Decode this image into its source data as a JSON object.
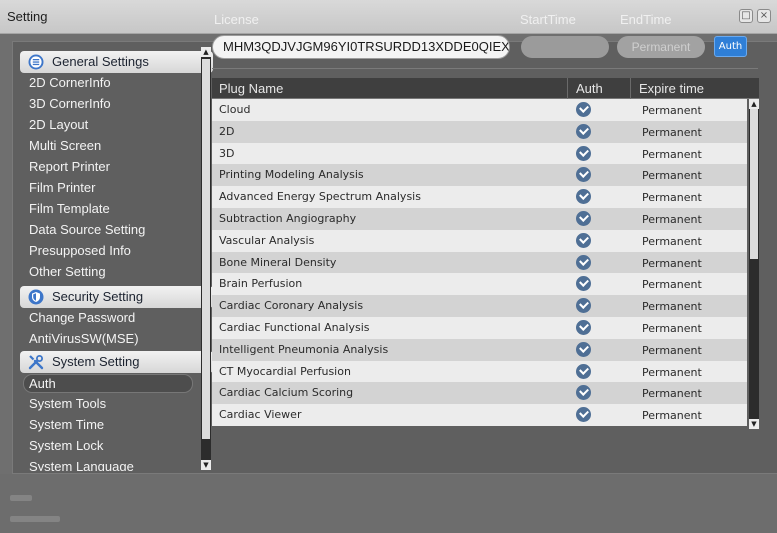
{
  "window": {
    "title": "Setting"
  },
  "sidebar": {
    "sections": [
      {
        "label": "General Settings",
        "icon": "list-circle-icon",
        "items": [
          "2D CornerInfo",
          "3D CornerInfo",
          "2D Layout",
          "Multi Screen",
          "Report Printer",
          "Film Printer",
          "Film Template",
          "Data Source Setting",
          "Presupposed Info",
          "Other Setting"
        ]
      },
      {
        "label": "Security Setting",
        "icon": "shield-icon",
        "items": [
          "Change Password",
          "AntiVirusSW(MSE)"
        ]
      },
      {
        "label": "System Setting",
        "icon": "tools-icon",
        "items": [
          "Auth",
          "System Tools",
          "System Time",
          "System Lock",
          "System Language"
        ]
      }
    ],
    "active_item": "Auth"
  },
  "license": {
    "label": "License",
    "start_label": "StartTime",
    "end_label": "EndTime",
    "key_value": "MHM3QDJVJGM96YI0TRSURDD13XDDE0QIEX...",
    "end_value": "Permanent",
    "auth_button": "Auth"
  },
  "table": {
    "columns": [
      "Plug Name",
      "Auth",
      "Expire time"
    ],
    "rows": [
      {
        "name": "Cloud",
        "expire": "Permanent"
      },
      {
        "name": "2D",
        "expire": "Permanent"
      },
      {
        "name": "3D",
        "expire": "Permanent"
      },
      {
        "name": "Printing Modeling Analysis",
        "expire": "Permanent"
      },
      {
        "name": "Advanced Energy Spectrum Analysis",
        "expire": "Permanent"
      },
      {
        "name": "Subtraction Angiography",
        "expire": "Permanent"
      },
      {
        "name": "Vascular Analysis",
        "expire": "Permanent"
      },
      {
        "name": "Bone Mineral Density",
        "expire": "Permanent"
      },
      {
        "name": "Brain Perfusion",
        "expire": "Permanent"
      },
      {
        "name": "Cardiac Coronary Analysis",
        "expire": "Permanent"
      },
      {
        "name": "Cardiac Functional Analysis",
        "expire": "Permanent"
      },
      {
        "name": "Intelligent Pneumonia Analysis",
        "expire": "Permanent"
      },
      {
        "name": "CT Myocardial Perfusion",
        "expire": "Permanent"
      },
      {
        "name": "Cardiac Calcium Scoring",
        "expire": "Permanent"
      },
      {
        "name": "Cardiac Viewer",
        "expire": "Permanent"
      }
    ]
  }
}
